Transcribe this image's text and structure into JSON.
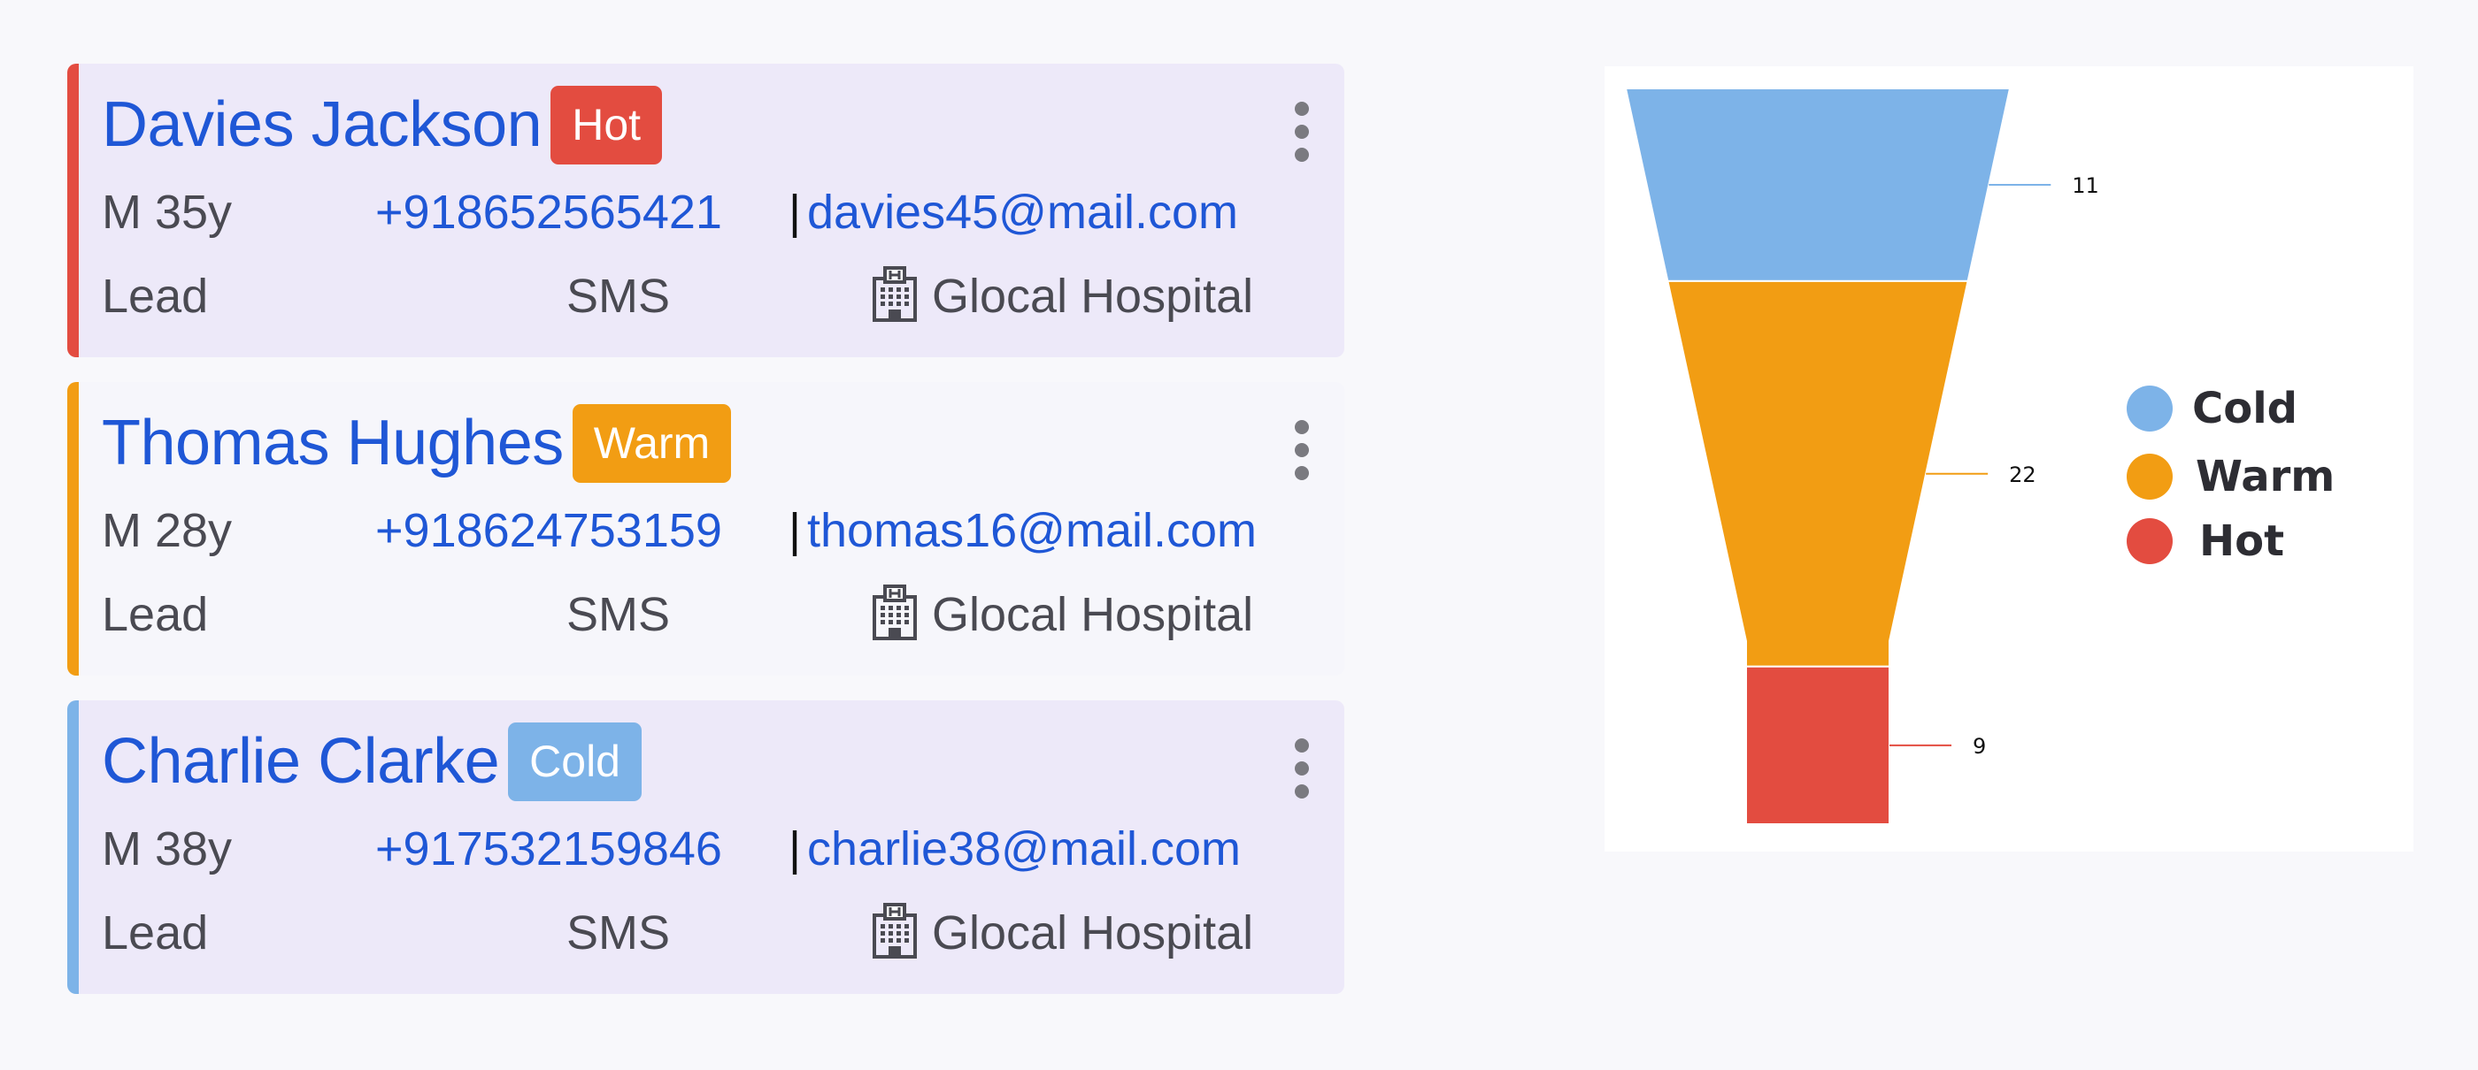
{
  "leads": [
    {
      "name": "Davies Jackson",
      "status": "Hot",
      "gender_age": "M 35y",
      "phone": "+918652565421",
      "separator": "|",
      "email": "davies45@mail.com",
      "type": "Lead",
      "channel": "SMS",
      "hospital": "Glocal Hospital",
      "hospital_icon": "hospital-building-icon",
      "menu_icon": "kebab-menu-icon"
    },
    {
      "name": "Thomas Hughes",
      "status": "Warm",
      "gender_age": "M 28y",
      "phone": "+918624753159",
      "separator": "|",
      "email": "thomas16@mail.com",
      "type": "Lead",
      "channel": "SMS",
      "hospital": "Glocal Hospital",
      "hospital_icon": "hospital-building-icon",
      "menu_icon": "kebab-menu-icon"
    },
    {
      "name": "Charlie Clarke",
      "status": "Cold",
      "gender_age": "M 38y",
      "phone": "+917532159846",
      "separator": "|",
      "email": "charlie38@mail.com",
      "type": "Lead",
      "channel": "SMS",
      "hospital": "Glocal Hospital",
      "hospital_icon": "hospital-building-icon",
      "menu_icon": "kebab-menu-icon"
    }
  ],
  "status_colors": {
    "Hot": "#e34c40",
    "Warm": "#f29d13",
    "Cold": "#7db3e8"
  },
  "colors": {
    "link": "#1f57d6",
    "text": "#4a4a52",
    "card_tint": "#ede9f9"
  },
  "chart_data": {
    "type": "funnel",
    "title": "",
    "categories": [
      "Cold",
      "Warm",
      "Hot"
    ],
    "values": [
      11,
      22,
      9
    ],
    "colors": [
      "#7db3e8",
      "#f29d13",
      "#e34c40"
    ],
    "data_labels": [
      "11",
      "22",
      "9"
    ],
    "legend": {
      "position": "right",
      "entries": [
        "Cold",
        "Warm",
        "Hot"
      ]
    }
  }
}
